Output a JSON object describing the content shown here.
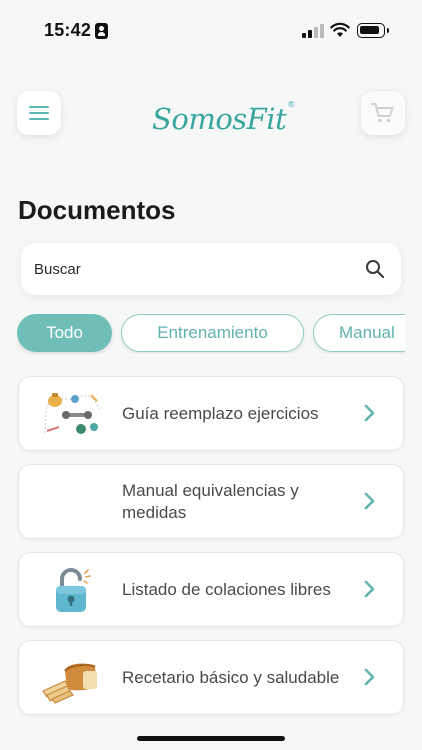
{
  "status_bar": {
    "time": "15:42"
  },
  "header": {
    "logo_text": "SomosFit",
    "logo_mark": "®",
    "menu_icon": "hamburger-icon",
    "cart_icon": "cart-icon"
  },
  "page": {
    "title": "Documentos"
  },
  "search": {
    "placeholder": "Buscar",
    "value": ""
  },
  "filters": [
    {
      "label": "Todo",
      "selected": true
    },
    {
      "label": "Entrenamiento",
      "selected": false
    },
    {
      "label": "Manual",
      "selected": false
    }
  ],
  "documents": [
    {
      "label": "Guía reemplazo ejercicios",
      "icon": "exercise-equipment-icon"
    },
    {
      "label": "Manual equivalencias y medidas",
      "icon": ""
    },
    {
      "label": "Listado de colaciones libres",
      "icon": "padlock-icon"
    },
    {
      "label": "Recetario básico y saludable",
      "icon": "bread-loaf-icon"
    }
  ],
  "colors": {
    "accent": "#6fbfb8",
    "logo": "#3aa6a0",
    "background": "#f6f8f7"
  }
}
